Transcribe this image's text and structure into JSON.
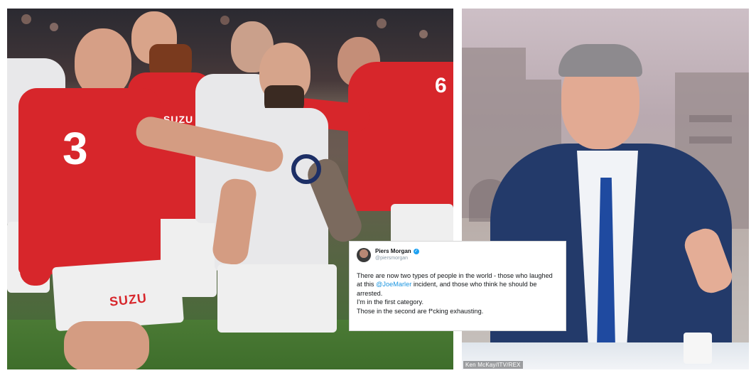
{
  "tweet": {
    "display_name": "Piers Morgan",
    "handle": "@piersmorgan",
    "verified_icon": "verified-badge-icon",
    "line1_before": "There are now two types of people in the world - those who laughed at this ",
    "mention": "@JoeMarler",
    "line1_after": " incident, and those who think he should be arrested.",
    "line2": "I'm in the first category.",
    "line3": "Those in the second are f*cking exhausting."
  },
  "left_photo": {
    "jersey_number_front": "3",
    "jersey_number_back": "6",
    "sponsor_text": "SUZU",
    "sponsor_text_2": "SUZU",
    "sponsor_text_3": "SUZU"
  },
  "right_photo": {
    "photo_credit": "Ken McKay/ITV/REX"
  },
  "colors": {
    "wales_red": "#d7262b",
    "england_white": "#e8e8ea",
    "suit_navy": "#233a6a",
    "tie_blue": "#1f4aa0",
    "link_blue": "#1b95e0"
  }
}
